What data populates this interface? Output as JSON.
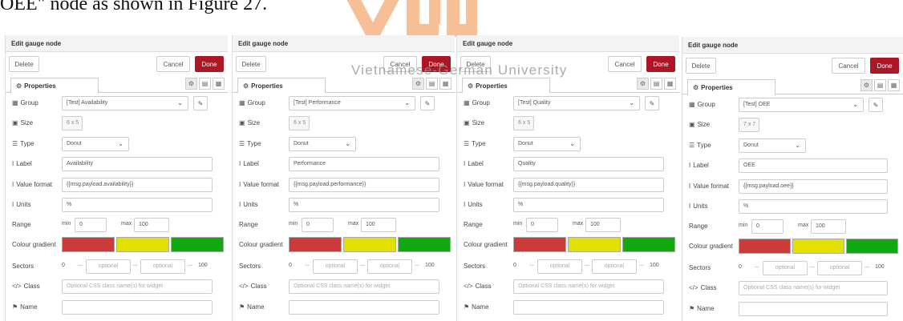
{
  "caption": "OEE\" node as shown in Figure 27.",
  "watermark": {
    "subtitle": "Vietnamese-German University",
    "color": "#f6b98a"
  },
  "labels": {
    "edit_title": "Edit gauge node",
    "delete": "Delete",
    "cancel": "Cancel",
    "done": "Done",
    "properties_tab": "Properties",
    "group": "Group",
    "size": "Size",
    "type": "Type",
    "label": "Label",
    "value_format": "Value format",
    "units": "Units",
    "range": "Range",
    "colour_gradient": "Colour gradient",
    "sectors": "Sectors",
    "class": "Class",
    "name": "Name",
    "min": "min",
    "max": "max",
    "optional": "optional",
    "class_placeholder": "Optional CSS class name(s) for widget",
    "sector_start": "0",
    "sector_end": "100",
    "ellipsis": "..."
  },
  "icons": {
    "gear": "gear-icon",
    "description": "document-icon",
    "layout": "grid-icon",
    "pencil": "pencil-icon",
    "caret": "chevron-down-icon"
  },
  "colors": {
    "done_button": "#ad1625",
    "gradient_red": "#cd3a3a",
    "gradient_yellow": "#e2e000",
    "gradient_green": "#10aa10"
  },
  "panels": [
    {
      "group": "[Test] Availability",
      "size": "6 x 5",
      "type": "Donut",
      "label": "Availability",
      "value_format": "{{msg.payload.availability}}",
      "units": "%",
      "min": "0",
      "max": "100"
    },
    {
      "group": "[Test] Performance",
      "size": "6 x 5",
      "type": "Donut",
      "label": "Performance",
      "value_format": "{{msg.payload.performance}}",
      "units": "%",
      "min": "0",
      "max": "100"
    },
    {
      "group": "[Test] Quality",
      "size": "6 x 5",
      "type": "Donut",
      "label": "Quality",
      "value_format": "{{msg.payload.quality}}",
      "units": "%",
      "min": "0",
      "max": "100"
    },
    {
      "group": "[Test] OEE",
      "size": "7 x 7",
      "type": "Donut",
      "label": "OEE",
      "value_format": "{{msg.payload.oee}}",
      "units": "%",
      "min": "0",
      "max": "100"
    }
  ]
}
